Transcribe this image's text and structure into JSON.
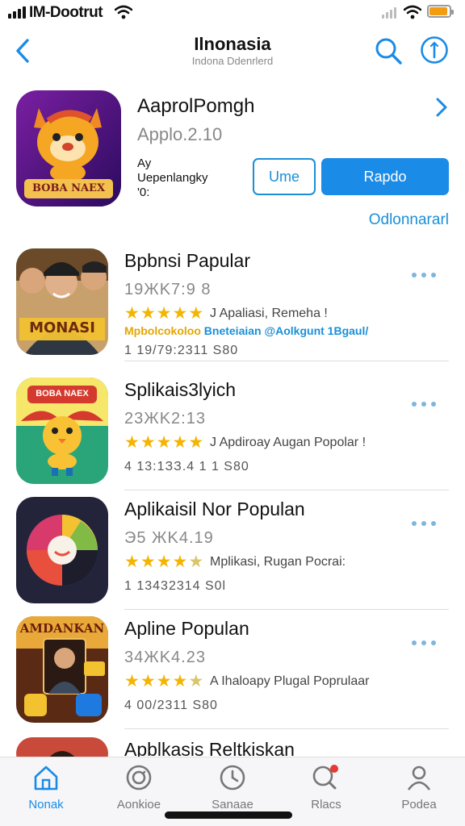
{
  "status_bar": {
    "carrier": "IM-Dootrut",
    "battery_level": 0.9,
    "battery_color": "#f39c12"
  },
  "nav": {
    "title": "Ilnonasia",
    "subtitle": "Indona Ddenrlerd",
    "back_icon": "chevron-left-icon",
    "search_icon": "search-icon",
    "info_icon": "info-icon"
  },
  "featured": {
    "title": "AaprolPomgh",
    "version": "Applo.2.10",
    "by_line1": "Ay",
    "by_line2": "Uepenlangky",
    "by_line3": "'0:",
    "secondary_button": "Ume",
    "primary_button": "Rapdo",
    "link": "Odlonnararl",
    "icon_text": "BOBA NAEX"
  },
  "apps": [
    {
      "name": "Bpbnsi Papular",
      "code": "19ЖK7:9 8",
      "rating": 5,
      "desc": "J Apaliasi, Remeha !",
      "tags_yellow": "Mpbolcokoloo",
      "tags_blue": "Bneteiaian @Aolkgunt 1Bgaul/",
      "size": "1 19/79:2311  S80",
      "icon_text": "MONASI"
    },
    {
      "name": "Splikais3lyich",
      "code": "23ЖK2:13",
      "rating": 5,
      "desc": "J Apdiroay  Augan Popolar !",
      "tags_yellow": "",
      "tags_blue": "",
      "size": "4 13:1ЗЗ.4 1 1  S80",
      "icon_text": "BOBA NAEX"
    },
    {
      "name": "Aplikaisil Nor Populan",
      "code": "Э5 ЖK4.19",
      "rating": 4.5,
      "desc": "Mplikasi, Rugan Pocrai:",
      "tags_yellow": "",
      "tags_blue": "",
      "size": "1 13432314  S0l",
      "icon_text": ""
    },
    {
      "name": "Apline Populan",
      "code": "34ЖK4.23",
      "rating": 4.5,
      "desc": "A Ihaloapy  Plugal  Poprulaar",
      "tags_yellow": "",
      "tags_blue": "",
      "size": "4 00/2311  S80",
      "icon_text": "AMDANKAN"
    },
    {
      "name": "Apblkasis Reltkiskan",
      "code": "",
      "rating": 0,
      "desc": "",
      "tags_yellow": "",
      "tags_blue": "",
      "size": "",
      "icon_text": ""
    }
  ],
  "tabs": [
    {
      "label": "Nonak",
      "icon": "home-icon",
      "active": true
    },
    {
      "label": "Aonkioe",
      "icon": "refresh-icon",
      "active": false
    },
    {
      "label": "Sanaae",
      "icon": "clock-icon",
      "active": false
    },
    {
      "label": "Rlacs",
      "icon": "search-icon",
      "active": false,
      "badge": true
    },
    {
      "label": "Podea",
      "icon": "person-icon",
      "active": false
    }
  ],
  "colors": {
    "accent": "#1a8be6",
    "star": "#f4b400"
  }
}
